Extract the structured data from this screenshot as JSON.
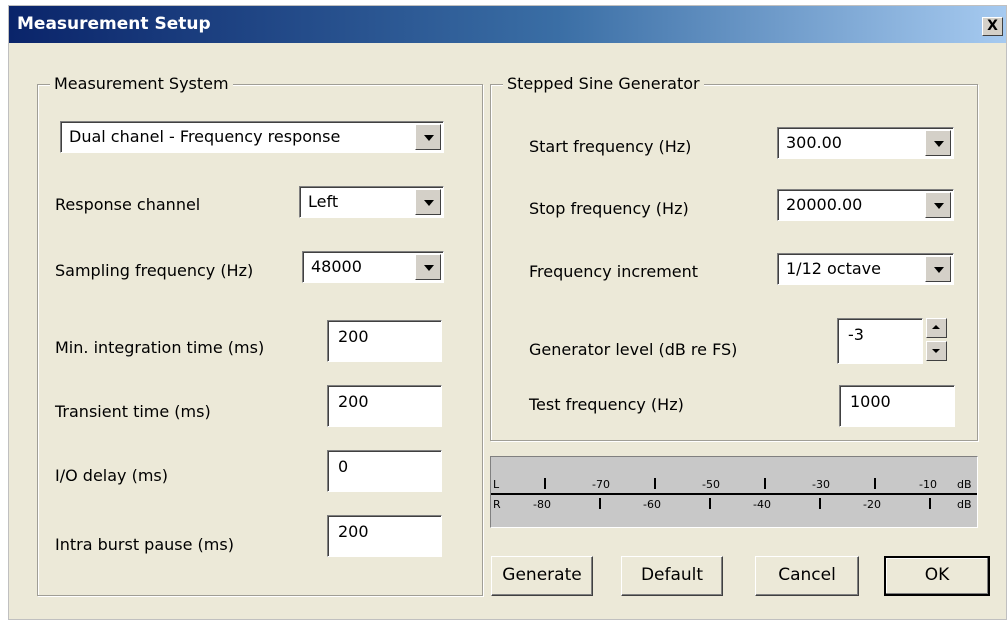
{
  "window": {
    "title": "Measurement Setup",
    "close_label": "X"
  },
  "measurement_system": {
    "legend": "Measurement System",
    "mode": "Dual chanel - Frequency response",
    "response_channel_label": "Response channel",
    "response_channel_value": "Left",
    "sampling_label": "Sampling frequency (Hz)",
    "sampling_value": "48000",
    "min_integration_label": "Min. integration time (ms)",
    "min_integration_value": "200",
    "transient_label": "Transient time (ms)",
    "transient_value": "200",
    "io_delay_label": "I/O delay (ms)",
    "io_delay_value": "0",
    "intra_burst_label": "Intra burst pause (ms)",
    "intra_burst_value": "200"
  },
  "generator": {
    "legend": "Stepped Sine Generator",
    "start_label": "Start frequency (Hz)",
    "start_value": "300.00",
    "stop_label": "Stop frequency (Hz)",
    "stop_value": "20000.00",
    "increment_label": "Frequency increment",
    "increment_value": "1/12 octave",
    "level_label": "Generator level (dB re FS)",
    "level_value": "-3",
    "test_label": "Test frequency (Hz)",
    "test_value": "1000"
  },
  "meter": {
    "left_channel": "L",
    "right_channel": "R",
    "top_scale": [
      "-70",
      "-50",
      "-30",
      "-10"
    ],
    "bottom_scale": [
      "-80",
      "-60",
      "-40",
      "-20"
    ],
    "unit": "dB"
  },
  "buttons": {
    "generate": "Generate",
    "default": "Default",
    "cancel": "Cancel",
    "ok": "OK"
  }
}
